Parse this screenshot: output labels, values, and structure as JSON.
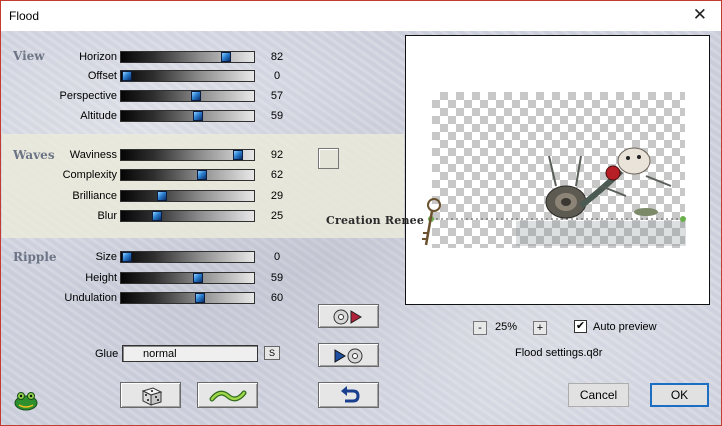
{
  "window": {
    "title": "Flood",
    "close_glyph": "✕"
  },
  "sections": {
    "view": "View",
    "waves": "Waves",
    "ripple": "Ripple"
  },
  "sliders": {
    "horizon": {
      "label": "Horizon",
      "value": "82",
      "fraction": 0.82
    },
    "offset": {
      "label": "Offset",
      "value": "0",
      "fraction": 0.0
    },
    "perspective": {
      "label": "Perspective",
      "value": "57",
      "fraction": 0.57
    },
    "altitude": {
      "label": "Altitude",
      "value": "59",
      "fraction": 0.59
    },
    "waviness": {
      "label": "Waviness",
      "value": "92",
      "fraction": 0.92
    },
    "complexity": {
      "label": "Complexity",
      "value": "62",
      "fraction": 0.62
    },
    "brilliance": {
      "label": "Brilliance",
      "value": "29",
      "fraction": 0.29
    },
    "blur": {
      "label": "Blur",
      "value": "25",
      "fraction": 0.25
    },
    "size": {
      "label": "Size",
      "value": "0",
      "fraction": 0.0
    },
    "height": {
      "label": "Height",
      "value": "59",
      "fraction": 0.59
    },
    "undulation": {
      "label": "Undulation",
      "value": "60",
      "fraction": 0.6
    }
  },
  "glue": {
    "label": "Glue",
    "value": "normal",
    "icon_text": "S"
  },
  "preview": {
    "zoom_minus": "-",
    "zoom_value": "25%",
    "zoom_plus": "+",
    "auto_preview_label": "Auto preview",
    "auto_preview_checked": "✔",
    "settings_file": "Flood settings.q8r",
    "watermark": "Creation Renee"
  },
  "buttons": {
    "cancel": "Cancel",
    "ok": "OK"
  },
  "icons": {
    "logo": "frog-logo-icon",
    "dice": "dice-icon",
    "wave": "wave-icon",
    "undo": "undo-icon",
    "load": "load-preset-icon",
    "save": "save-preset-icon"
  },
  "colors": {
    "accent": "#1b6ec2",
    "section_title": "#6c7486",
    "band": "#ecebd9"
  }
}
